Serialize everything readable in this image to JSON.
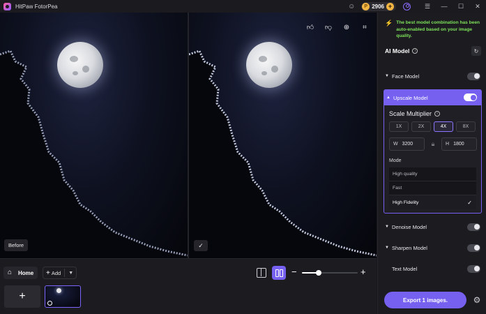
{
  "app": {
    "title": "HitPaw FotorPea"
  },
  "titlebar": {
    "coins": "2906"
  },
  "preview": {
    "before_label": "Before",
    "check_badge": "✓"
  },
  "bottom": {
    "home_label": "Home",
    "add_label": "Add",
    "zoom_level": 0.3
  },
  "panel": {
    "hint": "The best model combination has been auto-enabled based on your image quality.",
    "ai_model_title": "AI Model",
    "models": [
      {
        "label": "Face Model",
        "enabled": false
      },
      {
        "label": "Upscale Model",
        "enabled": true
      },
      {
        "label": "Denoise Model",
        "enabled": false
      },
      {
        "label": "Sharpen Model",
        "enabled": false
      },
      {
        "label": "Text Model",
        "enabled": false
      }
    ],
    "upscale": {
      "scale_title": "Scale Multiplier",
      "scales": [
        "1X",
        "2X",
        "4X",
        "8X"
      ],
      "selected_scale": "4X",
      "width_label": "W",
      "width": "3200",
      "height_label": "H",
      "height": "1800",
      "mode_title": "Mode",
      "modes": [
        "High quality",
        "Fast",
        "High Fidelity"
      ],
      "selected_mode": "High Fidelity"
    },
    "export_label": "Export 1 images."
  },
  "colors": {
    "accent": "#7560f0",
    "hint": "#7ee35a",
    "coin": "#f2b544"
  }
}
